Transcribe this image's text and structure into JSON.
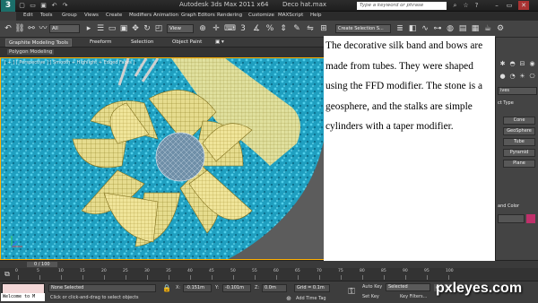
{
  "app": {
    "title": "Autodesk 3ds Max  2011 x64",
    "file": "Deco hat.max",
    "search_placeholder": "Type a keyword or phrase"
  },
  "menu": [
    "Edit",
    "Tools",
    "Group",
    "Views",
    "Create",
    "Modifiers",
    "Animation",
    "Graph Editors",
    "Rendering",
    "Customize",
    "MAXScript",
    "Help"
  ],
  "toolbar": {
    "selection_filter": "All",
    "reference_coord": "View",
    "named_selection": "Create Selection S..."
  },
  "ribbon": {
    "tabs": [
      "Graphite Modeling Tools",
      "Freeform",
      "Selection",
      "Object Paint"
    ],
    "panel": "Polygon Modeling"
  },
  "viewport": {
    "label": "[ + ] [ Perspective ] [ Smooth + Highlight + Edged Faces ]"
  },
  "overlay": {
    "text": "The decorative silk band and bows are made from tubes. They were shaped using the FFD modifier. The stone is a geosphere, and the stalks are simple cylinders with a taper modifier."
  },
  "command_panel": {
    "category": "ives",
    "section": "ct Type",
    "buttons": [
      "Cone",
      "GeoSphere",
      "Tube",
      "Pyramid",
      "Plane"
    ],
    "color_section": "and Color",
    "color": "#c0306a"
  },
  "timeline": {
    "slider": "0 / 100",
    "ticks": [
      "0",
      "5",
      "10",
      "15",
      "20",
      "25",
      "30",
      "35",
      "40",
      "45",
      "50",
      "55",
      "60",
      "65",
      "70",
      "75",
      "80",
      "85",
      "90",
      "95",
      "100"
    ]
  },
  "status": {
    "maxscript": "Welcome to M",
    "selection": "None Selected",
    "prompt": "Click or click-and-drag to select objects",
    "x": "-0.151m",
    "y": "-0.101m",
    "z": "0.0m",
    "grid": "Grid = 0.1m",
    "add_time_tag": "Add Time Tag",
    "auto_key": "Auto Key",
    "set_key": "Set Key",
    "key_mode": "Selected",
    "key_filters": "Key Filters..."
  },
  "watermark": "pxleyes.com"
}
